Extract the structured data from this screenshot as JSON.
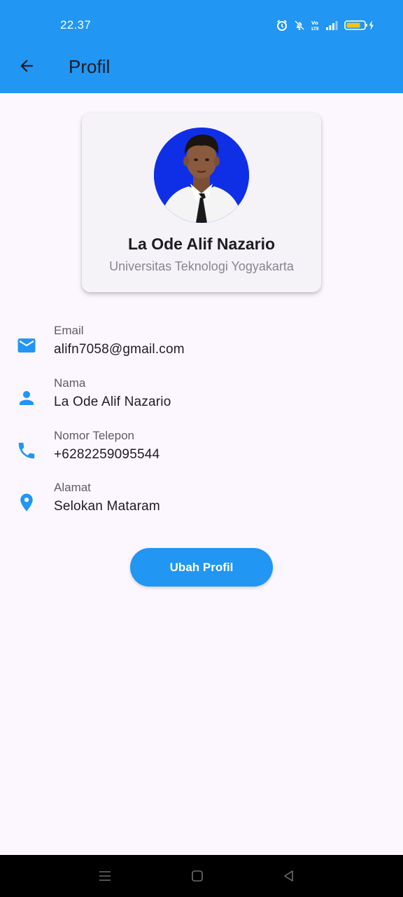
{
  "status_bar": {
    "time": "22.37",
    "icons": [
      "alarm-icon",
      "silent-bell-icon",
      "volte-icon",
      "signal-icon",
      "battery-charging-icon"
    ]
  },
  "app_bar": {
    "title": "Profil",
    "back_icon": "arrow-back-icon"
  },
  "profile": {
    "name": "La Ode Alif Nazario",
    "university": "Universitas Teknologi Yogyakarta"
  },
  "info": [
    {
      "icon": "email-icon",
      "label": "Email",
      "value": "alifn7058@gmail.com"
    },
    {
      "icon": "person-icon",
      "label": "Nama",
      "value": "La Ode Alif Nazario"
    },
    {
      "icon": "phone-icon",
      "label": "Nomor Telepon",
      "value": "+6282259095544"
    },
    {
      "icon": "location-pin-icon",
      "label": "Alamat",
      "value": "Selokan Mataram"
    }
  ],
  "actions": {
    "edit_label": "Ubah Profil"
  },
  "nav_bar": {
    "icons": [
      "menu-icon",
      "home-icon",
      "back-triangle-icon"
    ]
  },
  "colors": {
    "primary": "#2196f3",
    "background": "#fcf7fe",
    "card": "#f5f2f8",
    "text": "#1f1b22",
    "muted": "#8a868f"
  }
}
